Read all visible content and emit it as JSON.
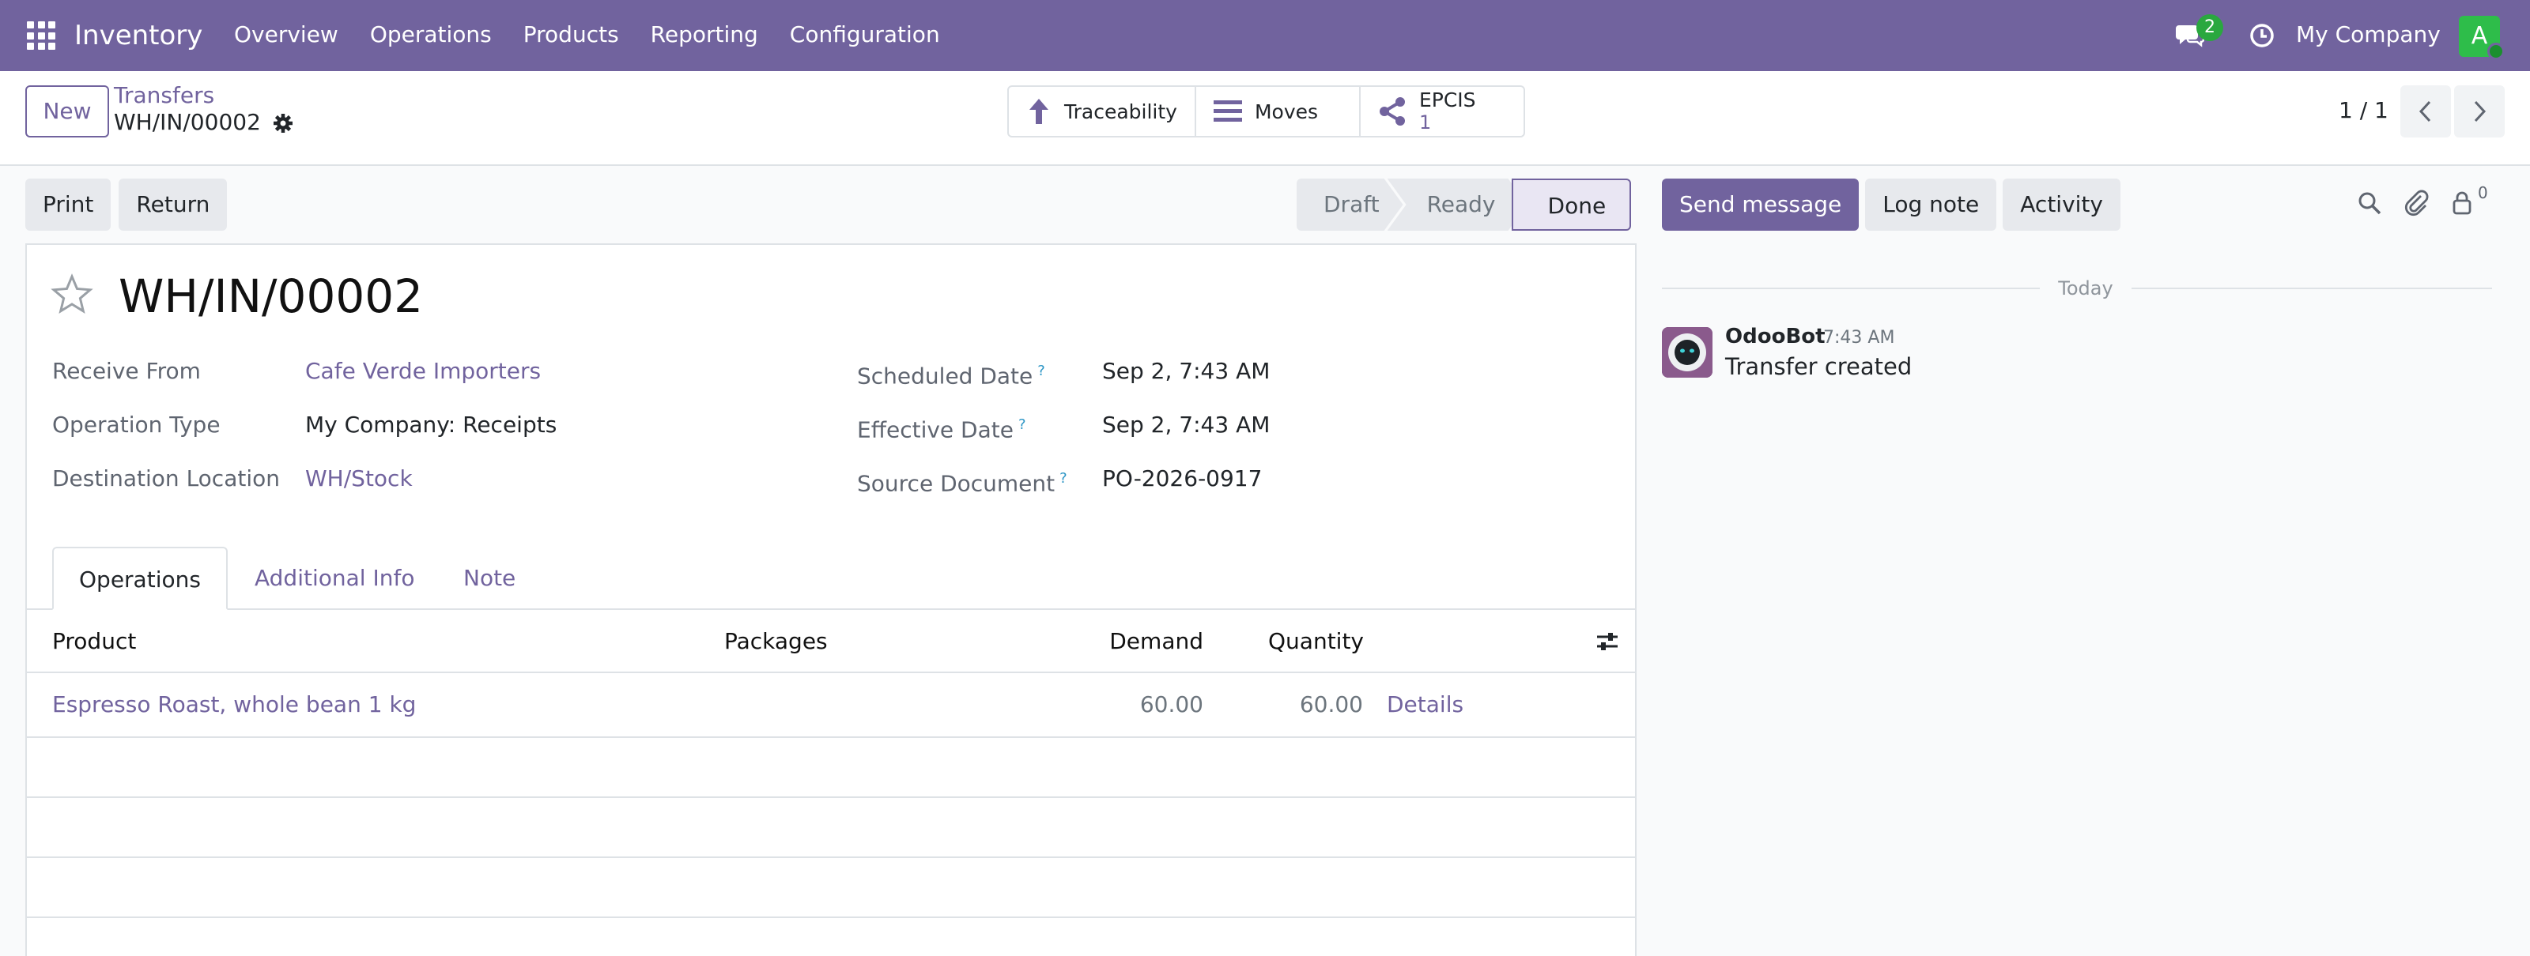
{
  "navbar": {
    "app_name": "Inventory",
    "menu": [
      "Overview",
      "Operations",
      "Products",
      "Reporting",
      "Configuration"
    ],
    "chat_badge": "2",
    "company": "My Company",
    "avatar_letter": "A"
  },
  "control_panel": {
    "new_label": "New",
    "breadcrumb_parent": "Transfers",
    "breadcrumb_current": "WH/IN/00002",
    "smart_buttons": {
      "traceability": "Traceability",
      "moves": "Moves",
      "epcis_label": "EPCIS",
      "epcis_count": "1"
    },
    "pager": "1 / 1"
  },
  "statusbar": {
    "print": "Print",
    "return": "Return",
    "stages": [
      "Draft",
      "Ready",
      "Done"
    ],
    "current_stage": "Done"
  },
  "form": {
    "title": "WH/IN/00002",
    "fields": {
      "receive_from_label": "Receive From",
      "receive_from": "Cafe Verde Importers",
      "operation_type_label": "Operation Type",
      "operation_type": "My Company: Receipts",
      "destination_label": "Destination Location",
      "destination": "WH/Stock",
      "scheduled_label": "Scheduled Date",
      "scheduled": "Sep 2, 7:43 AM",
      "effective_label": "Effective Date",
      "effective": "Sep 2, 7:43 AM",
      "source_doc_label": "Source Document",
      "source_doc": "PO-2026-0917",
      "help_mark": "?"
    },
    "tabs": [
      "Operations",
      "Additional Info",
      "Note"
    ],
    "table": {
      "headers": {
        "product": "Product",
        "packages": "Packages",
        "demand": "Demand",
        "quantity": "Quantity"
      },
      "rows": [
        {
          "product": "Espresso Roast, whole bean 1 kg",
          "demand": "60.00",
          "quantity": "60.00",
          "details": "Details"
        }
      ]
    }
  },
  "chatter": {
    "send_message": "Send message",
    "log_note": "Log note",
    "activity": "Activity",
    "followers_count": "0",
    "today": "Today",
    "message": {
      "author": "OdooBot",
      "time": "7:43 AM",
      "body": "Transfer created"
    }
  },
  "colors": {
    "brand": "#71639e",
    "badge": "#2aa83f",
    "help": "#2b95c5"
  }
}
